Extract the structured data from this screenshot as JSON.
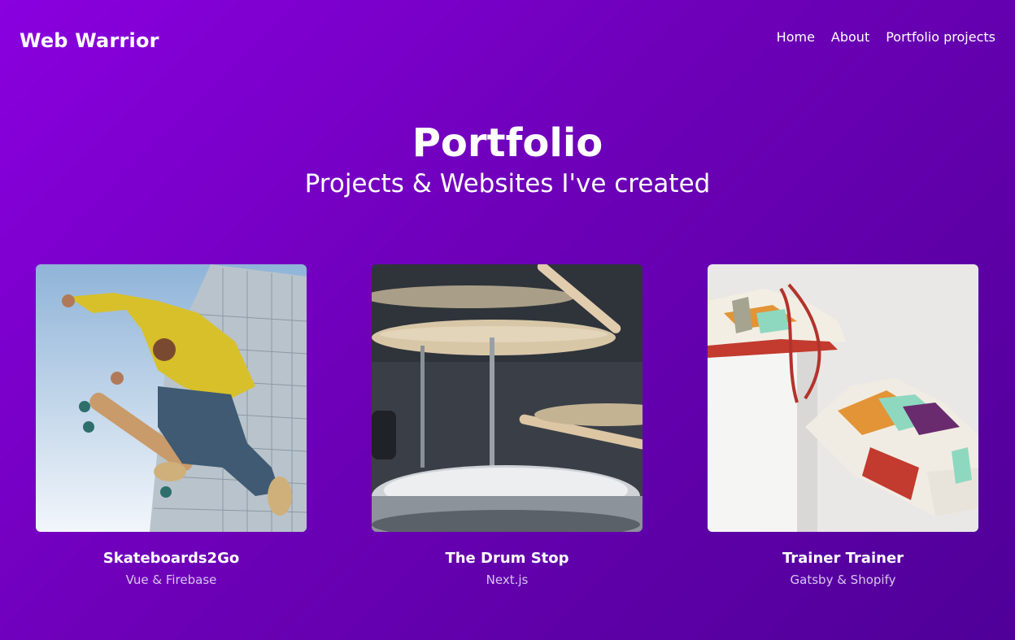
{
  "nav": {
    "brand": "Web Warrior",
    "links": [
      "Home",
      "About",
      "Portfolio projects"
    ]
  },
  "hero": {
    "title": "Portfolio",
    "subtitle": "Projects & Websites I've created"
  },
  "projects": [
    {
      "title": "Skateboards2Go",
      "tech": "Vue & Firebase",
      "image_icon": "skateboarder-photo"
    },
    {
      "title": "The Drum Stop",
      "tech": "Next.js",
      "image_icon": "drum-kit-photo"
    },
    {
      "title": "Trainer Trainer",
      "tech": "Gatsby & Shopify",
      "image_icon": "sneakers-photo"
    }
  ],
  "colors": {
    "gradient_start": "#8a00df",
    "gradient_end": "#4f0098",
    "subtext": "#d9c6f0"
  }
}
